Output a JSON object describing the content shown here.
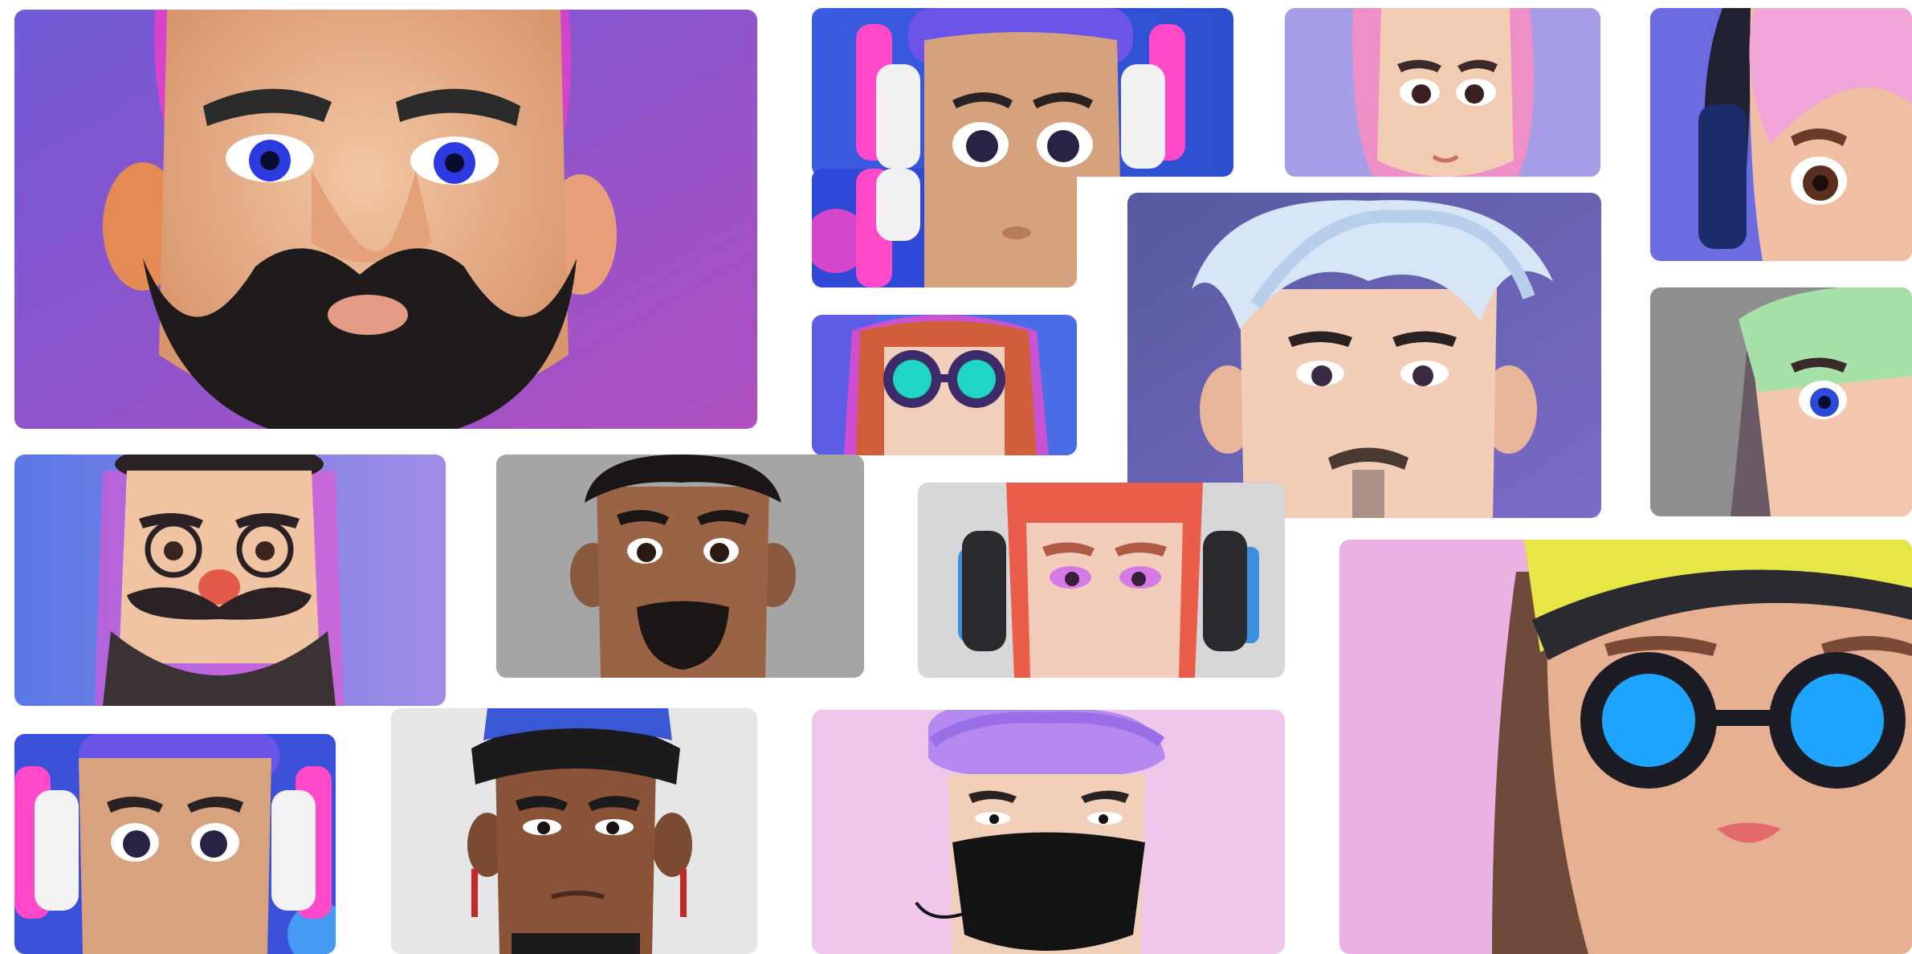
{
  "gallery": {
    "tiles": [
      {
        "avatar": "bearded-man-avatar",
        "background": "#8a52c9"
      },
      {
        "avatar": "girl-headphones-avatar",
        "background": "#3d4fd6"
      },
      {
        "avatar": "pink-hair-girl-avatar",
        "background": "#a59de6"
      },
      {
        "avatar": "pink-hair-headset-avatar",
        "background": "#6f6ae0"
      },
      {
        "avatar": "white-hair-man-avatar",
        "background": "#6e6ab6"
      },
      {
        "avatar": "goggles-redhead-avatar",
        "background": "#4b6be6"
      },
      {
        "avatar": "green-beanie-avatar",
        "background": "#8d8d8d"
      },
      {
        "avatar": "mustache-glasses-avatar",
        "background": "#7a7ee0"
      },
      {
        "avatar": "dark-skin-man-avatar",
        "background": "#a7a7a7"
      },
      {
        "avatar": "redhead-headphones-avatar",
        "background": "#d6d6d6"
      },
      {
        "avatar": "yellow-beanie-goggles-avatar",
        "background": "#eab1e3"
      },
      {
        "avatar": "girl-headphones-small-avatar",
        "background": "#3d4fd6"
      },
      {
        "avatar": "black-cap-man-avatar",
        "background": "#e6e6e6"
      },
      {
        "avatar": "purple-hair-mask-avatar",
        "background": "#efc6ea"
      }
    ]
  }
}
